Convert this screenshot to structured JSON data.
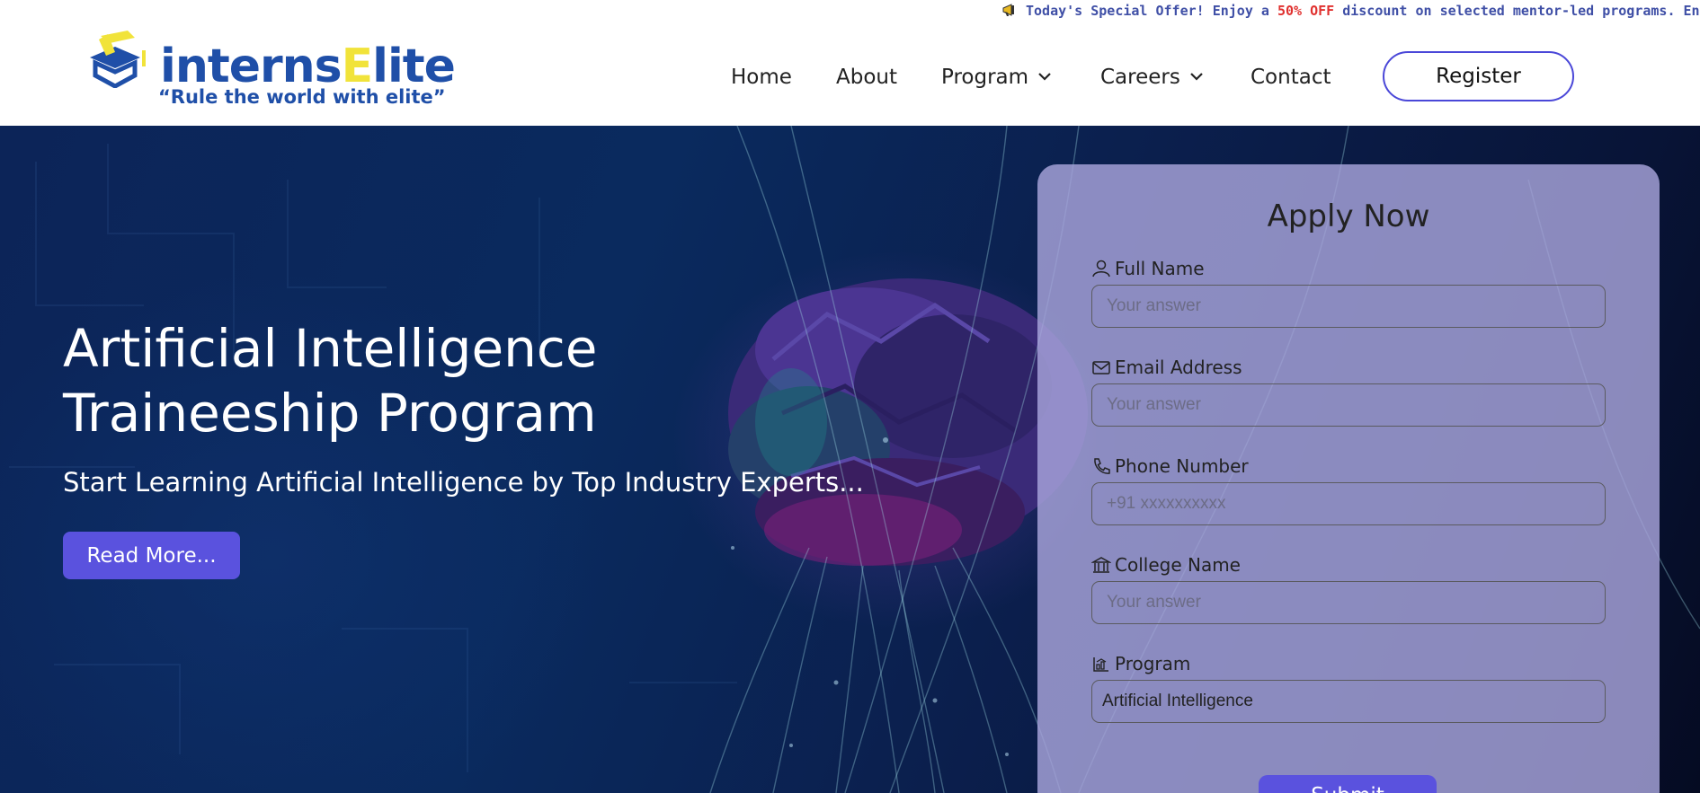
{
  "offer": {
    "prefix": "Today's Special Offer! Enjoy a ",
    "highlight": "50% OFF",
    "suffix": " discount on selected mentor-led programs. Enhance"
  },
  "brand": {
    "name_part1": "interns",
    "name_part2": "E",
    "name_part3": "lite",
    "tagline": "“Rule the world with elite”"
  },
  "nav": {
    "items": [
      {
        "label": "Home",
        "has_dropdown": false
      },
      {
        "label": "About",
        "has_dropdown": false
      },
      {
        "label": "Program",
        "has_dropdown": true
      },
      {
        "label": "Careers",
        "has_dropdown": true
      },
      {
        "label": "Contact",
        "has_dropdown": false
      }
    ],
    "register_label": "Register"
  },
  "hero": {
    "title": "Artificial Intelligence Traineeship Program",
    "subtitle": "Start Learning Artificial Intelligence by Top Industry Experts...",
    "cta_label": "Read More..."
  },
  "form": {
    "title": "Apply Now",
    "fields": [
      {
        "label": "Full Name",
        "icon": "user-icon",
        "placeholder": "Your answer"
      },
      {
        "label": "Email Address",
        "icon": "mail-icon",
        "placeholder": "Your answer"
      },
      {
        "label": "Phone Number",
        "icon": "phone-icon",
        "placeholder": "+91 xxxxxxxxxx"
      },
      {
        "label": "College Name",
        "icon": "building-icon",
        "placeholder": "Your answer"
      }
    ],
    "program_label": "Program",
    "program_value": "Artificial Intelligence",
    "submit_label": "Submit"
  },
  "colors": {
    "brand_blue": "#1f4fa8",
    "brand_yellow": "#f1e33a",
    "accent": "#5a52de",
    "offer_red": "#e0312f"
  }
}
